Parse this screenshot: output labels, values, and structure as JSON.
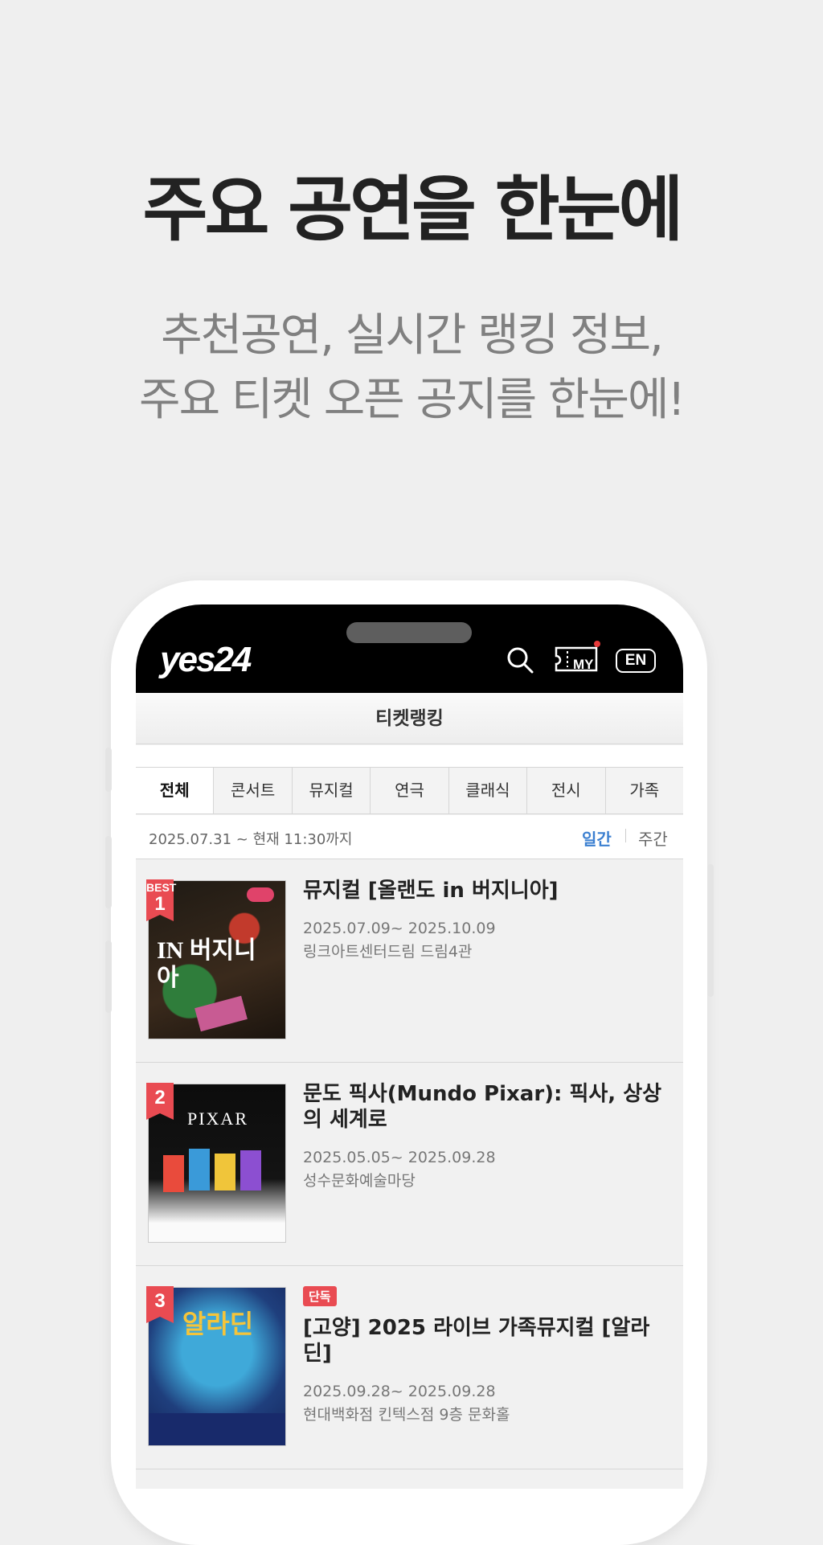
{
  "promo": {
    "headline": "주요 공연을 한눈에",
    "sub_line1": "추천공연, 실시간 랭킹 정보,",
    "sub_line2": "주요 티켓 오픈 공지를 한눈에!"
  },
  "app_header": {
    "logo": "yes24",
    "my_label": "MY",
    "lang_button": "EN"
  },
  "page_title": "티켓랭킹",
  "tabs": [
    {
      "label": "전체",
      "active": true
    },
    {
      "label": "콘서트"
    },
    {
      "label": "뮤지컬"
    },
    {
      "label": "연극"
    },
    {
      "label": "클래식"
    },
    {
      "label": "전시"
    },
    {
      "label": "가족"
    }
  ],
  "period": {
    "range": "2025.07.31 ~ 현재 11:30까지",
    "daily": "일간",
    "weekly": "주간"
  },
  "rankings": [
    {
      "badge_top": "BEST",
      "rank": "1",
      "title": "뮤지컬 [올랜도 in 버지니아]",
      "date": "2025.07.09~ 2025.10.09",
      "venue": "링크아트센터드림 드림4관",
      "poster_text": "IN 버지니아"
    },
    {
      "rank": "2",
      "title": "문도 픽사(Mundo Pixar): 픽사, 상상의 세계로",
      "date": "2025.05.05~ 2025.09.28",
      "venue": "성수문화예술마당",
      "poster_text": "PIXAR"
    },
    {
      "rank": "3",
      "label": "단독",
      "title": "[고양] 2025 라이브 가족뮤지컬 [알라딘]",
      "date": "2025.09.28~ 2025.09.28",
      "venue": "현대백화점 킨텍스점 9층 문화홀",
      "poster_text": "알라딘"
    }
  ],
  "colors": {
    "accent": "#3b7fd0",
    "badge": "#e94b52",
    "background": "#efefef"
  }
}
